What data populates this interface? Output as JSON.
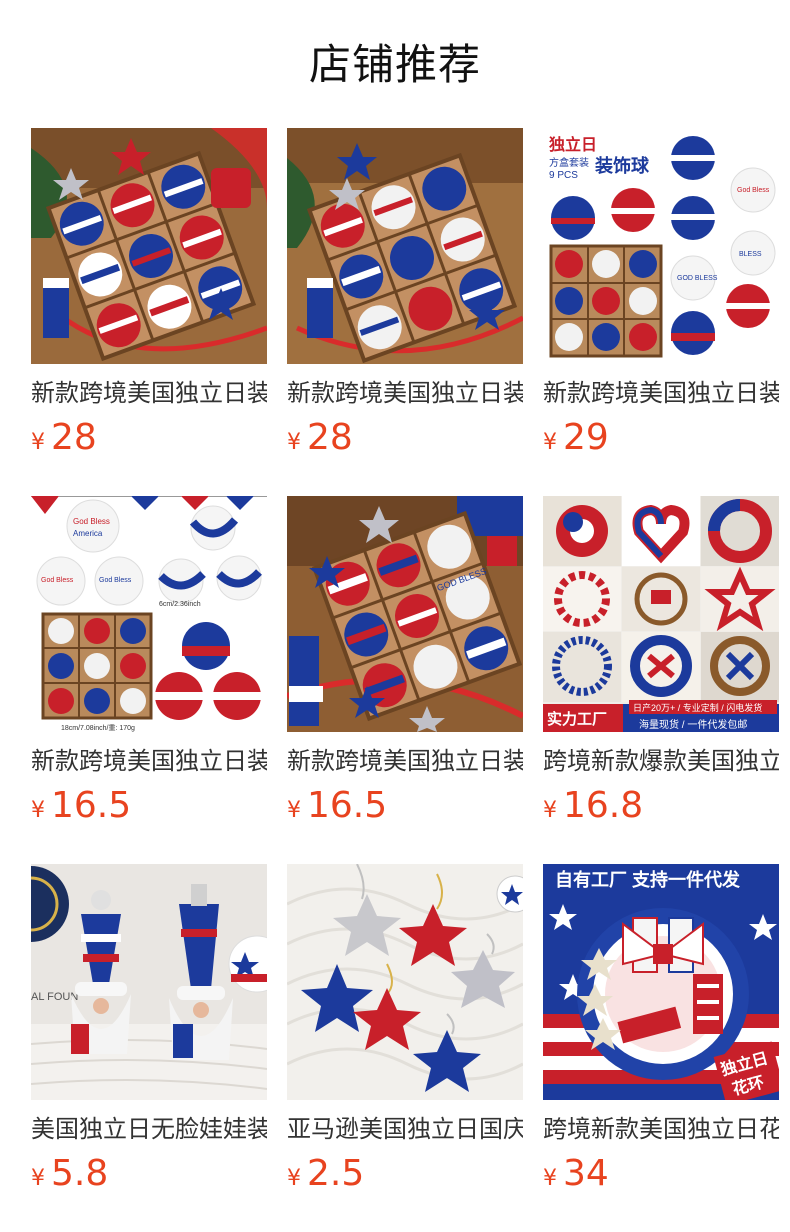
{
  "header": {
    "title": "店铺推荐"
  },
  "currency_symbol": "¥",
  "colors": {
    "price": "#e8431f",
    "title": "#333333",
    "heading": "#111111"
  },
  "products": [
    {
      "title": "新款跨境美国独立日装饰球",
      "price": "28",
      "image": "ornament-box-photo"
    },
    {
      "title": "新款跨境美国独立日装饰球",
      "price": "28",
      "image": "ornament-box-photo"
    },
    {
      "title": "新款跨境美国独立日装饰球",
      "price": "29",
      "image": "ornament-set-catalog",
      "image_text": [
        "独立日",
        "方盒套装",
        "9 PCS",
        "装饰球",
        "GOD BLESS AMERICA",
        "God Bless America"
      ]
    },
    {
      "title": "新款跨境美国独立日装饰球",
      "price": "16.5",
      "image": "ornament-size-chart",
      "image_text": [
        "God Bless America",
        "6cm/2.36inch",
        "18cm/7.08inch/重: 170g"
      ]
    },
    {
      "title": "新款跨境美国独立日装饰球",
      "price": "16.5",
      "image": "ornament-box-photo",
      "image_text": [
        "GOD BLESS"
      ]
    },
    {
      "title": "跨境新款爆款美国独立日花环",
      "price": "16.8",
      "image": "wreath-collage",
      "image_text": [
        "实力工厂",
        "日产20万+ / 专业定制 / 闪电发货",
        "海量现货 / 一件代发包邮"
      ]
    },
    {
      "title": "美国独立日无脸娃娃装饰",
      "price": "5.8",
      "image": "gnome-dolls",
      "image_text": [
        "AL FOUN"
      ]
    },
    {
      "title": "亚马逊美国独立日国庆星星挂件",
      "price": "2.5",
      "image": "star-ornaments"
    },
    {
      "title": "跨境新款美国独立日花环",
      "price": "34",
      "image": "bow-wreath",
      "image_text": [
        "自有工厂 支持一件代发",
        "独立日",
        "花环"
      ]
    }
  ]
}
